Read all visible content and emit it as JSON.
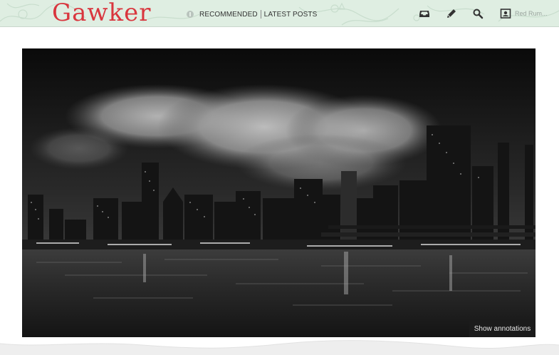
{
  "header": {
    "logo": "Gawker",
    "nav": [
      "RECOMMENDED",
      "LATEST POSTS"
    ],
    "user_name": "Red Rum..."
  },
  "icons": {
    "inbox": "inbox-icon",
    "compose": "pencil-icon",
    "search": "search-icon",
    "profile": "user-card-icon",
    "nav": "info-dot-icon"
  },
  "photo": {
    "annotations_label": "Show annotations"
  },
  "colors": {
    "brand": "#d9363e",
    "header_bg": "#dfeee2"
  }
}
